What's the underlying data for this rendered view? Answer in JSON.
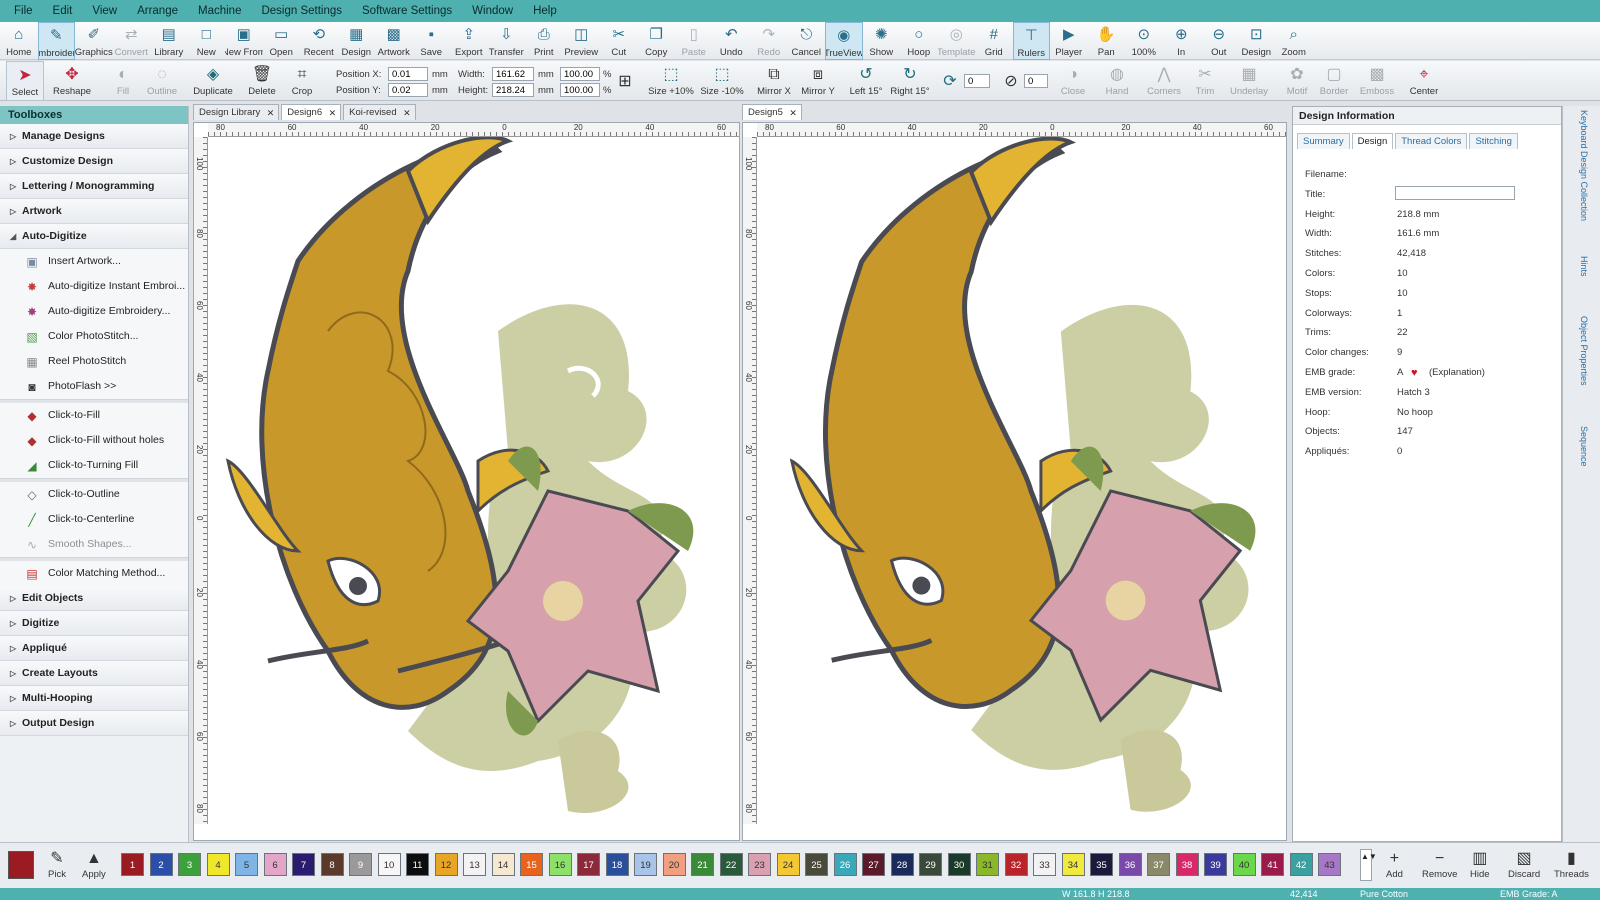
{
  "menu": [
    "File",
    "Edit",
    "View",
    "Arrange",
    "Machine",
    "Design Settings",
    "Software Settings",
    "Window",
    "Help"
  ],
  "toolbar1": [
    {
      "label": "Home",
      "icon": "home-icon",
      "glyph": "⌂"
    },
    {
      "label": "Embroidery",
      "icon": "embroidery-icon",
      "glyph": "✎",
      "active": true
    },
    {
      "label": "Graphics",
      "icon": "graphics-icon",
      "glyph": "✐"
    },
    {
      "label": "Convert",
      "icon": "convert-icon",
      "glyph": "⇄",
      "dim": true
    },
    {
      "label": "Library",
      "icon": "library-icon",
      "glyph": "▤"
    },
    {
      "label": "New",
      "icon": "new-icon",
      "glyph": "□"
    },
    {
      "label": "New From",
      "icon": "new-from-icon",
      "glyph": "▣"
    },
    {
      "label": "Open",
      "icon": "open-icon",
      "glyph": "▭"
    },
    {
      "label": "Recent",
      "icon": "recent-icon",
      "glyph": "⟲"
    },
    {
      "label": "Design",
      "icon": "design-icon",
      "glyph": "▦"
    },
    {
      "label": "Artwork",
      "icon": "artwork-icon",
      "glyph": "▩"
    },
    {
      "label": "Save",
      "icon": "save-icon",
      "glyph": "▪"
    },
    {
      "label": "Export",
      "icon": "export-icon",
      "glyph": "⇪"
    },
    {
      "label": "Transfer",
      "icon": "transfer-icon",
      "glyph": "⇩"
    },
    {
      "label": "Print",
      "icon": "print-icon",
      "glyph": "⎙"
    },
    {
      "label": "Preview",
      "icon": "preview-icon",
      "glyph": "◫"
    },
    {
      "label": "Cut",
      "icon": "cut-icon",
      "glyph": "✂"
    },
    {
      "label": "Copy",
      "icon": "copy-icon",
      "glyph": "❐"
    },
    {
      "label": "Paste",
      "icon": "paste-icon",
      "glyph": "▯",
      "dim": true
    },
    {
      "label": "Undo",
      "icon": "undo-icon",
      "glyph": "↶"
    },
    {
      "label": "Redo",
      "icon": "redo-icon",
      "glyph": "↷",
      "dim": true
    },
    {
      "label": "Cancel",
      "icon": "cancel-icon",
      "glyph": "⎋"
    },
    {
      "label": "TrueView",
      "icon": "trueview-icon",
      "glyph": "◉",
      "active": true
    },
    {
      "label": "Show",
      "icon": "show-icon",
      "glyph": "✺"
    },
    {
      "label": "Hoop",
      "icon": "hoop-icon",
      "glyph": "○"
    },
    {
      "label": "Template",
      "icon": "template-icon",
      "glyph": "◎",
      "dim": true
    },
    {
      "label": "Grid",
      "icon": "grid-icon",
      "glyph": "#"
    },
    {
      "label": "Rulers",
      "icon": "rulers-icon",
      "glyph": "⊤",
      "active": true
    },
    {
      "label": "Player",
      "icon": "player-icon",
      "glyph": "▶"
    },
    {
      "label": "Pan",
      "icon": "pan-icon",
      "glyph": "✋"
    },
    {
      "label": "100%",
      "icon": "zoom-100-icon",
      "glyph": "⊙"
    },
    {
      "label": "In",
      "icon": "zoom-in-icon",
      "glyph": "⊕"
    },
    {
      "label": "Out",
      "icon": "zoom-out-icon",
      "glyph": "⊖"
    },
    {
      "label": "Design",
      "icon": "zoom-design-icon",
      "glyph": "⊡"
    },
    {
      "label": "Zoom",
      "icon": "zoom-icon",
      "glyph": "⌕"
    }
  ],
  "toolbar2": {
    "select": "Select",
    "reshape": "Reshape",
    "fill": "Fill",
    "outline": "Outline",
    "duplicate": "Duplicate",
    "delete": "Delete",
    "crop": "Crop",
    "position_x_label": "Position X:",
    "position_x": "0.01",
    "position_y_label": "Position Y:",
    "position_y": "0.02",
    "unit": "mm",
    "width_label": "Width:",
    "width": "161.62",
    "height_label": "Height:",
    "height": "218.24",
    "scale_w": "100.00",
    "scale_h": "100.00",
    "percent": "%",
    "size_up": "Size +10%",
    "size_down": "Size -10%",
    "mirror_x": "Mirror X",
    "mirror_y": "Mirror Y",
    "left15": "Left 15°",
    "right15": "Right 15°",
    "rot_value": "0",
    "slant_value": "0",
    "close": "Close",
    "hand": "Hand",
    "corners": "Corners",
    "trim": "Trim",
    "underlay": "Underlay",
    "motif": "Motif",
    "border": "Border",
    "emboss": "Emboss",
    "center": "Center"
  },
  "toolboxes": {
    "title": "Toolboxes",
    "sections_top": [
      "Manage Designs",
      "Customize Design",
      "Lettering / Monogramming",
      "Artwork"
    ],
    "auto_digitize": "Auto-Digitize",
    "items_a": [
      {
        "label": "Insert Artwork...",
        "icon": "insert-artwork-icon",
        "color": "#7a8aa0",
        "glyph": "▣"
      },
      {
        "label": "Auto-digitize Instant Embroi...",
        "icon": "auto-digitize-instant-icon",
        "color": "#c04040",
        "glyph": "✸"
      },
      {
        "label": "Auto-digitize Embroidery...",
        "icon": "auto-digitize-embroidery-icon",
        "color": "#a04080",
        "glyph": "✸"
      },
      {
        "label": "Color PhotoStitch...",
        "icon": "color-photostitch-icon",
        "color": "#4aa04a",
        "glyph": "▧"
      },
      {
        "label": "Reel PhotoStitch",
        "icon": "reel-photostitch-icon",
        "color": "#888888",
        "glyph": "▦"
      },
      {
        "label": "PhotoFlash >>",
        "icon": "photoflash-icon",
        "color": "#333333",
        "glyph": "◙"
      }
    ],
    "items_b": [
      {
        "label": "Click-to-Fill",
        "icon": "click-to-fill-icon",
        "color": "#b03030",
        "glyph": "◆"
      },
      {
        "label": "Click-to-Fill without holes",
        "icon": "click-to-fill-no-holes-icon",
        "color": "#b03030",
        "glyph": "◆"
      },
      {
        "label": "Click-to-Turning Fill",
        "icon": "click-to-turning-fill-icon",
        "color": "#3a8a3a",
        "glyph": "◢"
      }
    ],
    "items_c": [
      {
        "label": "Click-to-Outline",
        "icon": "click-to-outline-icon",
        "color": "#666666",
        "glyph": "◇"
      },
      {
        "label": "Click-to-Centerline",
        "icon": "click-to-centerline-icon",
        "color": "#3a8a3a",
        "glyph": "╱"
      },
      {
        "label": "Smooth Shapes...",
        "icon": "smooth-shapes-icon",
        "color": "#aaaaaa",
        "glyph": "∿",
        "dim": true
      }
    ],
    "items_d": [
      {
        "label": "Color Matching Method...",
        "icon": "color-matching-icon",
        "color": "#c03030",
        "glyph": "▤"
      }
    ],
    "sections_bottom": [
      "Edit Objects",
      "Digitize",
      "Appliqué",
      "Create Layouts",
      "Multi-Hooping",
      "Output Design"
    ]
  },
  "left_doc": {
    "tabs": [
      "Design Library",
      "Design6",
      "Koi-revised"
    ],
    "ruler_h": [
      "80",
      "60",
      "40",
      "20",
      "0",
      "20",
      "40",
      "60"
    ],
    "ruler_v": [
      "100",
      "80",
      "60",
      "40",
      "20",
      "0",
      "20",
      "40",
      "60",
      "80"
    ]
  },
  "right_doc": {
    "tabs": [
      "Design5"
    ],
    "ruler_h": [
      "80",
      "60",
      "40",
      "20",
      "0",
      "20",
      "40",
      "60"
    ],
    "ruler_v": [
      "100",
      "80",
      "60",
      "40",
      "20",
      "0",
      "20",
      "40",
      "60",
      "80"
    ]
  },
  "design_info": {
    "title": "Design Information",
    "tabs": [
      "Summary",
      "Design",
      "Thread Colors",
      "Stitching"
    ],
    "rows": [
      {
        "k": "Filename:",
        "v": ""
      },
      {
        "k": "Title:",
        "v": ""
      },
      {
        "k": "Height:",
        "v": "218.8 mm"
      },
      {
        "k": "Width:",
        "v": "161.6 mm"
      },
      {
        "k": "Stitches:",
        "v": "42,418"
      },
      {
        "k": "Colors:",
        "v": "10"
      },
      {
        "k": "Stops:",
        "v": "10"
      },
      {
        "k": "Colorways:",
        "v": "1"
      },
      {
        "k": "Trims:",
        "v": "22"
      },
      {
        "k": "Color changes:",
        "v": "9"
      },
      {
        "k": "EMB grade:",
        "v": "A"
      },
      {
        "k": "EMB version:",
        "v": "Hatch 3"
      },
      {
        "k": "Hoop:",
        "v": "No hoop"
      },
      {
        "k": "Objects:",
        "v": "147"
      },
      {
        "k": "Appliqués:",
        "v": "0"
      }
    ],
    "explanation": "(Explanation)"
  },
  "side_tabs": [
    "Keyboard Design Collection",
    "Hints",
    "Object Properties",
    "Sequence"
  ],
  "palette": {
    "pick": "Pick",
    "apply": "Apply",
    "add": "Add",
    "remove": "Remove",
    "hide": "Hide",
    "discard": "Discard",
    "threads": "Threads",
    "current_color": "#9b1b22",
    "swatches": [
      {
        "n": "1",
        "c": "#9b1b22"
      },
      {
        "n": "2",
        "c": "#2b4fa8"
      },
      {
        "n": "3",
        "c": "#3da13b"
      },
      {
        "n": "4",
        "c": "#f0e62a"
      },
      {
        "n": "5",
        "c": "#7fb4e6"
      },
      {
        "n": "6",
        "c": "#e4a6c8"
      },
      {
        "n": "7",
        "c": "#2a1b6e"
      },
      {
        "n": "8",
        "c": "#5a3a2a"
      },
      {
        "n": "9",
        "c": "#9a9a9a"
      },
      {
        "n": "10",
        "c": "#f6f6f6"
      },
      {
        "n": "11",
        "c": "#0d0d0d"
      },
      {
        "n": "12",
        "c": "#e8a628"
      },
      {
        "n": "13",
        "c": "#f3f3f3"
      },
      {
        "n": "14",
        "c": "#f5e7d0"
      },
      {
        "n": "15",
        "c": "#e8641e"
      },
      {
        "n": "16",
        "c": "#8de06a"
      },
      {
        "n": "17",
        "c": "#8a2a3a"
      },
      {
        "n": "18",
        "c": "#2a4f9a"
      },
      {
        "n": "19",
        "c": "#a8c4e8"
      },
      {
        "n": "20",
        "c": "#f0a080"
      },
      {
        "n": "21",
        "c": "#3a8a3a"
      },
      {
        "n": "22",
        "c": "#2a5a3a"
      },
      {
        "n": "23",
        "c": "#d8a0b0"
      },
      {
        "n": "24",
        "c": "#f4c832"
      },
      {
        "n": "25",
        "c": "#4a4a3a"
      },
      {
        "n": "26",
        "c": "#3aa8b8"
      },
      {
        "n": "27",
        "c": "#5a1a2a"
      },
      {
        "n": "28",
        "c": "#1a2a5a"
      },
      {
        "n": "29",
        "c": "#3a4a3a"
      },
      {
        "n": "30",
        "c": "#1a3a2a"
      },
      {
        "n": "31",
        "c": "#8ab82a"
      },
      {
        "n": "32",
        "c": "#b8242a"
      },
      {
        "n": "33",
        "c": "#f2f2f2"
      },
      {
        "n": "34",
        "c": "#f0ea40"
      },
      {
        "n": "35",
        "c": "#1a1a3a"
      },
      {
        "n": "36",
        "c": "#7a4aa8"
      },
      {
        "n": "37",
        "c": "#8a8a6a"
      },
      {
        "n": "38",
        "c": "#d8286a"
      },
      {
        "n": "39",
        "c": "#3a3a9a"
      },
      {
        "n": "40",
        "c": "#6ad84a"
      },
      {
        "n": "41",
        "c": "#9a1a4a"
      },
      {
        "n": "42",
        "c": "#3aa0a0"
      },
      {
        "n": "43",
        "c": "#a878c8"
      }
    ]
  },
  "status": {
    "dims": "W 161.8 H 218.8",
    "stitches": "42,414",
    "thread": "Pure Cotton",
    "grade": "EMB Grade: A"
  }
}
